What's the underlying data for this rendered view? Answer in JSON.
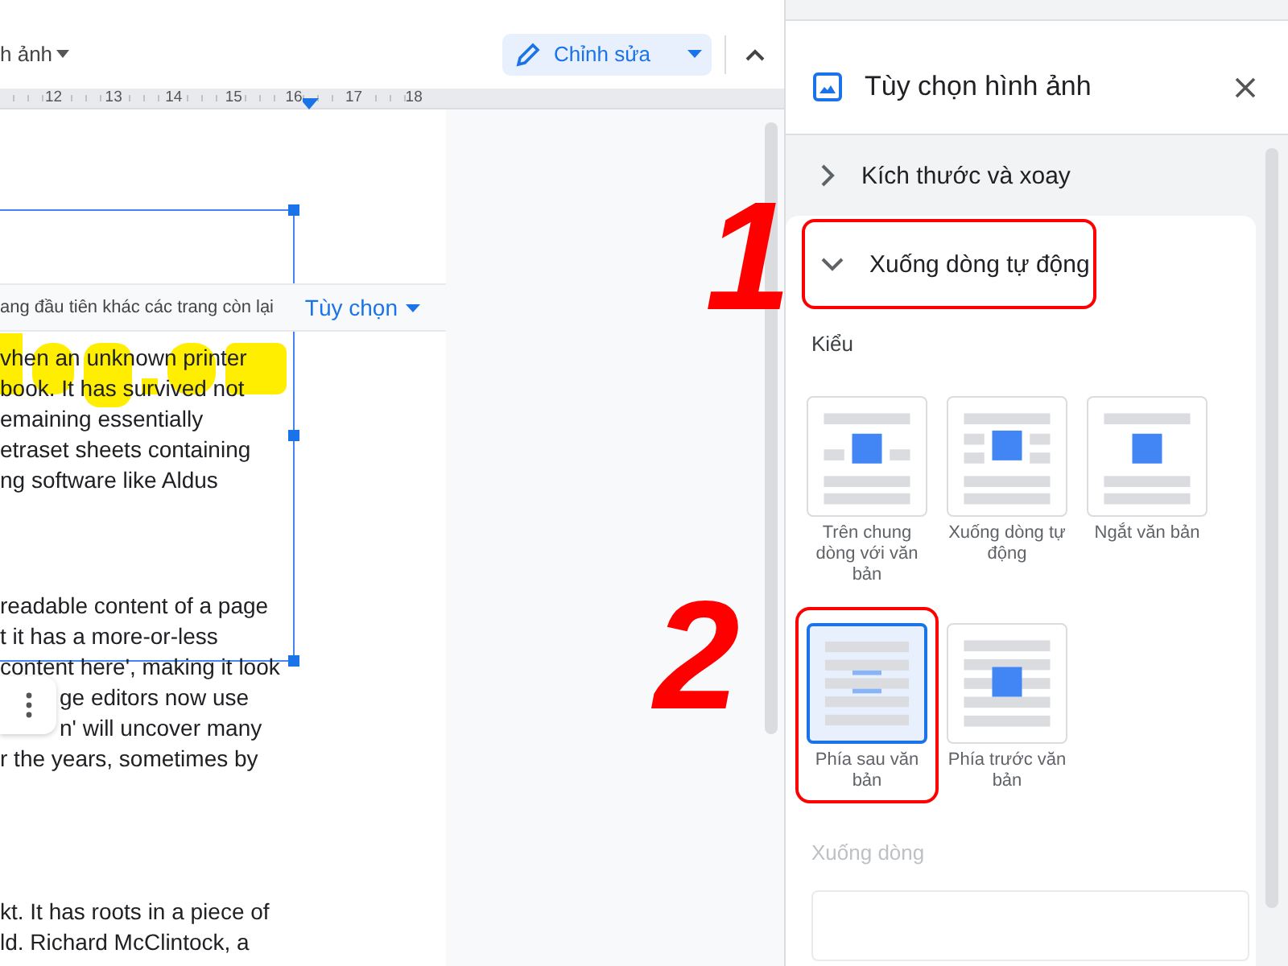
{
  "doc_toolbar": {
    "menu_label": "h ảnh",
    "mode_button": "Chỉnh sửa"
  },
  "ruler": {
    "ticks": [
      "12",
      "13",
      "14",
      "15",
      "16",
      "17",
      "18"
    ]
  },
  "image_toolbar": {
    "text": "ang đầu tiên khác các trang còn lại",
    "options_button": "Tùy chọn"
  },
  "document": {
    "paragraphs": [
      [
        "vhen an unknown printer",
        "book. It has survived not",
        "emaining essentially",
        "etraset sheets containing",
        "ng software like Aldus"
      ],
      [
        "readable content of a page",
        "t it has a more-or-less",
        "content here', making it look",
        "ge editors now use",
        "n' will uncover many",
        "r the years, sometimes by"
      ],
      [
        "kt. It has roots in a piece of",
        "ld. Richard McClintock, a"
      ]
    ]
  },
  "panel": {
    "title": "Tùy chọn hình ảnh",
    "sections": [
      {
        "label": "Kích thước và xoay",
        "expanded": false,
        "highlighted": false
      },
      {
        "label": "Xuống dòng tự động",
        "expanded": true,
        "highlighted": true
      }
    ],
    "wrap": {
      "heading": "Kiểu",
      "styles": [
        {
          "label": "Trên chung dòng với văn bản",
          "kind": "inline",
          "selected": false,
          "highlighted": false
        },
        {
          "label": "Xuống dòng tự động",
          "kind": "wrap",
          "selected": false,
          "highlighted": false
        },
        {
          "label": "Ngắt văn bản",
          "kind": "break",
          "selected": false,
          "highlighted": false
        },
        {
          "label": "Phía sau văn bản",
          "kind": "behind",
          "selected": true,
          "highlighted": true
        },
        {
          "label": "Phía trước văn bản",
          "kind": "front",
          "selected": false,
          "highlighted": false
        }
      ],
      "margin_heading": "Xuống dòng",
      "margin_disabled": true
    }
  },
  "annotations": [
    "1",
    "2"
  ]
}
